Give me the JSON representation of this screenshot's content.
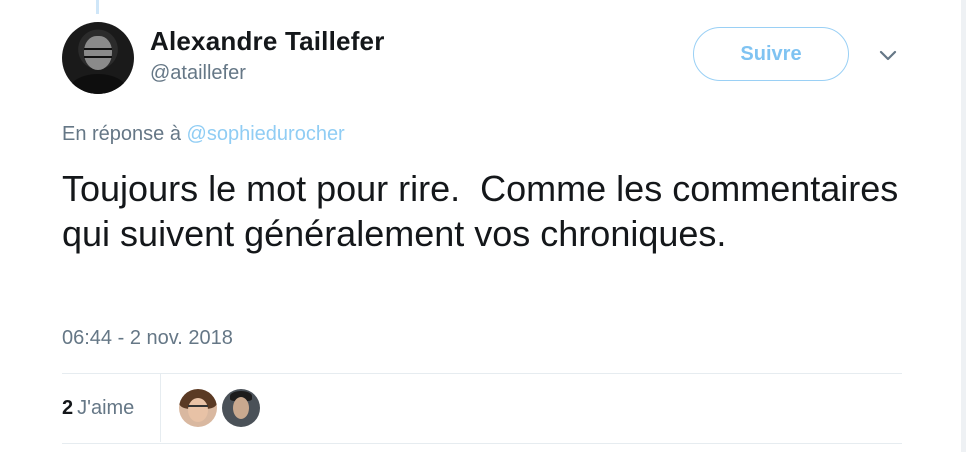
{
  "tweet": {
    "display_name": "Alexandre Taillefer",
    "handle": "@ataillefer",
    "follow_label": "Suivre",
    "reply_prefix": "En réponse à",
    "reply_mention": "@sophiedurocher",
    "text": "Toujours le mot pour rire.  Comme les commentaires qui suivent généralement vos chroniques.",
    "timestamp": "06:44 - 2 nov. 2018",
    "likes_count": "2",
    "likes_label": "J'aime"
  },
  "icons": {
    "menu": "chevron-down-icon"
  },
  "colors": {
    "accent": "#1da1f2",
    "follow_text": "#7fc3f2",
    "secondary_text": "#657786",
    "primary_text": "#14171a"
  }
}
